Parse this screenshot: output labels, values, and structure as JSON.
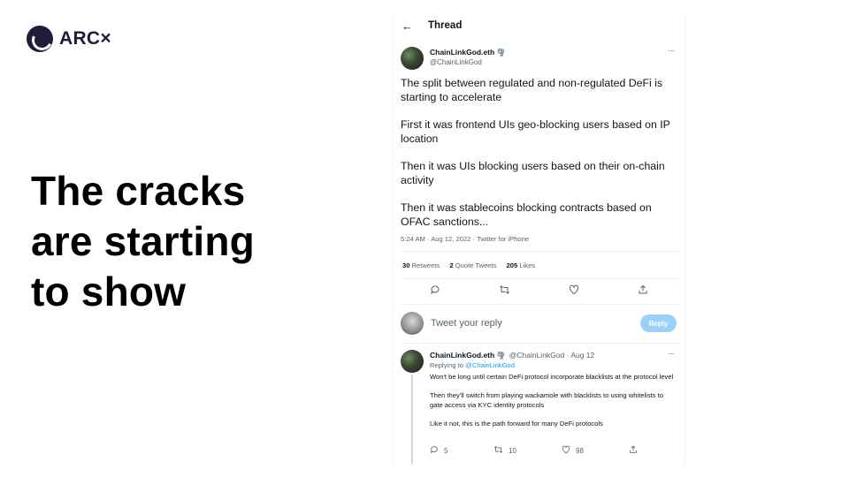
{
  "slide": {
    "logo_text": "ARC",
    "logo_suffix": "×",
    "headline": [
      "The cracks",
      "are starting",
      "to show"
    ]
  },
  "tweet": {
    "header_title": "Thread",
    "author_name": "ChainLinkGod.eth",
    "author_handle": "@ChainLinkGod",
    "paragraphs": [
      "The split between regulated and non-regulated DeFi is starting to accelerate",
      "First it was frontend UIs geo-blocking users based on IP location",
      "Then it was UIs blocking users based on their on-chain activity",
      "Then it was stablecoins blocking contracts based on OFAC sanctions..."
    ],
    "meta": "5:24 AM · Aug 12, 2022 · Twitter for iPhone",
    "stats": {
      "retweets_count": "30",
      "retweets_label": "Retweets",
      "quotes_count": "2",
      "quotes_label": "Quote Tweets",
      "likes_count": "205",
      "likes_label": "Likes"
    },
    "actions": [
      "reply-icon",
      "retweet-icon",
      "like-icon",
      "share-icon"
    ]
  },
  "composer": {
    "placeholder": "Tweet your reply",
    "button_label": "Reply"
  },
  "reply": {
    "author_name": "ChainLinkGod.eth",
    "handle_and_date": "@ChainLinkGod · Aug 12",
    "replying_prefix": "Replying to",
    "replying_to": "@ChainLinkGod",
    "paragraphs": [
      "Won't be long until certain DeFi protocol incorporate blacklists at the protocol level",
      "Then they'll switch from playing wackamole with blacklists to using whitelists to gate access via KYC identity protocols",
      "Like it not, this is the path forward for many DeFi protocols"
    ],
    "reply_count": "5",
    "retweet_count": "10",
    "like_count": "98"
  },
  "colors": {
    "brand": "#1f1d3a",
    "link": "#1d9bf0",
    "reply_button": "#9bd1f9",
    "muted_text": "#536471"
  }
}
